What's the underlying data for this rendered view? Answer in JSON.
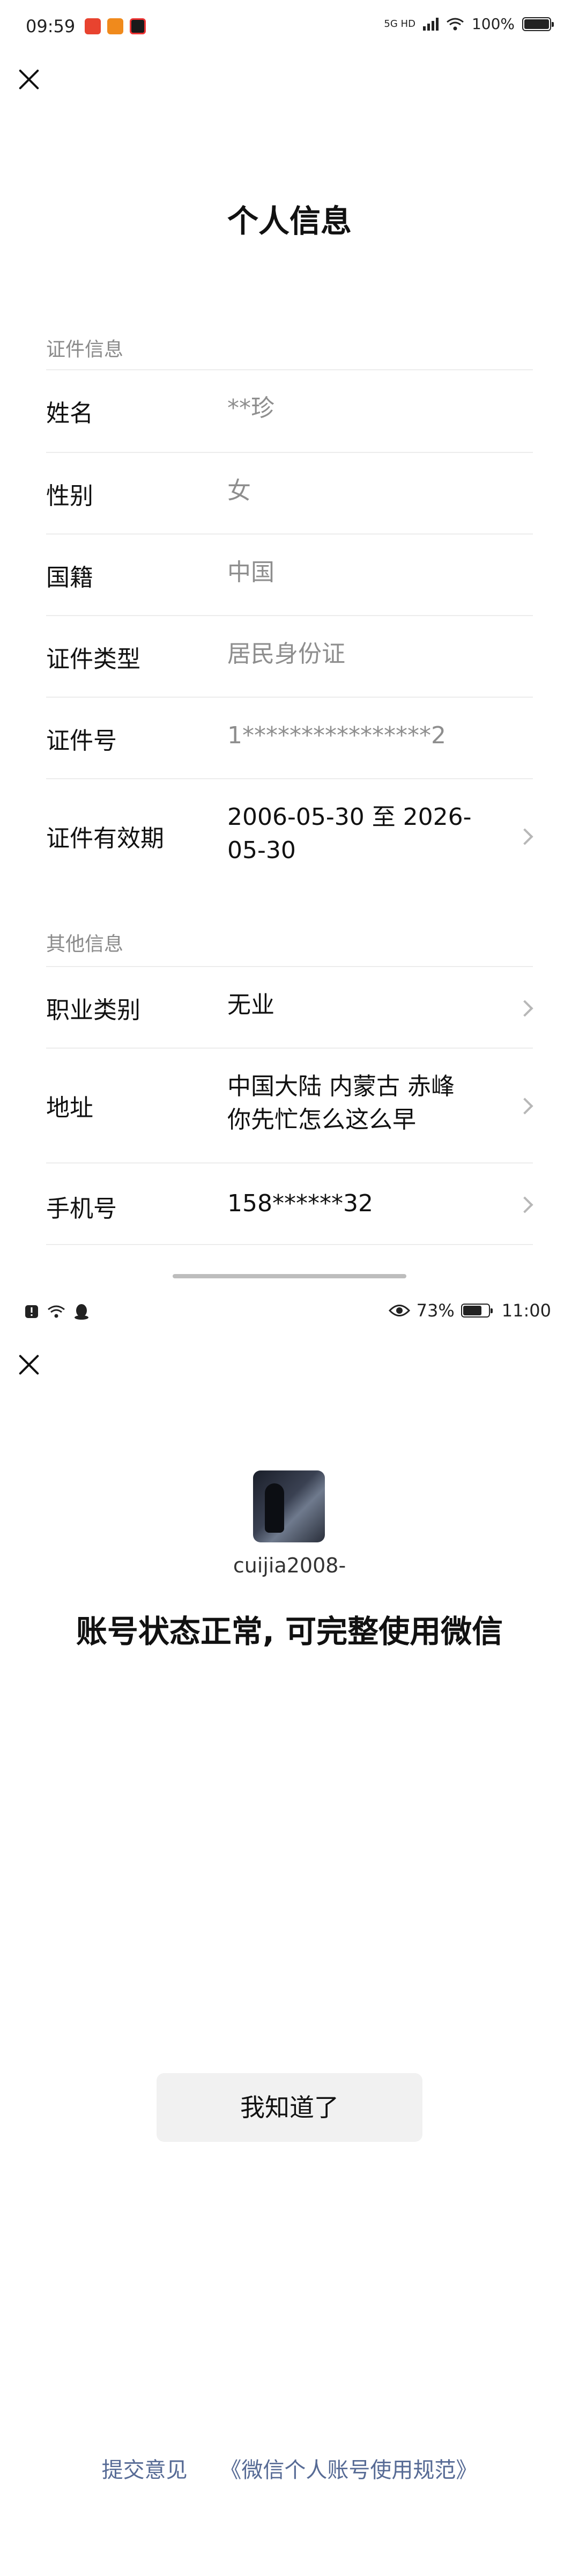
{
  "screen1": {
    "status_bar": {
      "time": "09:59",
      "network": "5G HD",
      "battery": "100%"
    },
    "title": "个人信息",
    "sections": [
      {
        "label": "证件信息",
        "rows": [
          {
            "label": "姓名",
            "value": "**珍"
          },
          {
            "label": "性别",
            "value": "女"
          },
          {
            "label": "国籍",
            "value": "中国"
          },
          {
            "label": "证件类型",
            "value": "居民身份证"
          },
          {
            "label": "证件号",
            "value": "1****************2"
          },
          {
            "label": "证件有效期",
            "value": "2006-05-30 至 2026-05-30"
          }
        ]
      },
      {
        "label": "其他信息",
        "rows": [
          {
            "label": "职业类别",
            "value": "无业"
          },
          {
            "label": "地址",
            "value": "中国大陆 内蒙古 赤峰 你先忙怎么这么早"
          },
          {
            "label": "手机号",
            "value": "158******32"
          }
        ]
      }
    ]
  },
  "screen2": {
    "status_bar": {
      "time": "11:00",
      "battery": "73%"
    },
    "username": "cuijia2008-",
    "status_message": "账号状态正常, 可完整使用微信",
    "ack_button": "我知道了",
    "footer": {
      "feedback": "提交意见",
      "rules": "《微信个人账号使用规范》"
    }
  },
  "colors": {
    "link": "#576b95",
    "secondary_text": "#8e8e8e",
    "button_bg": "#f1f1f1"
  }
}
